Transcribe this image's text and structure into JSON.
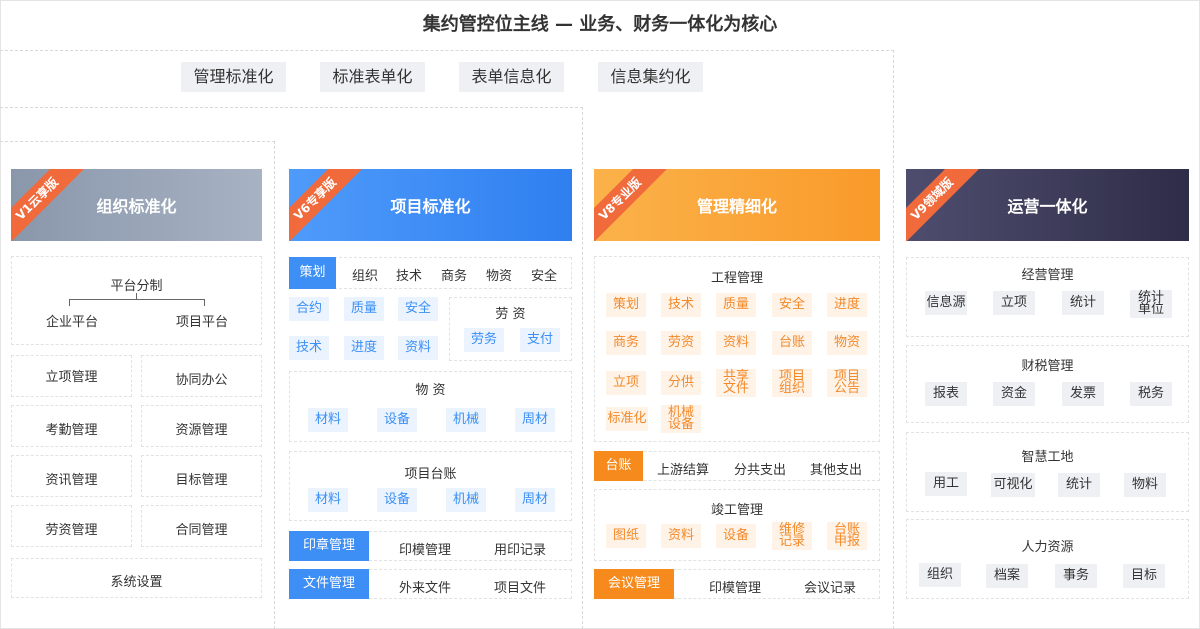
{
  "header": {
    "title": "集约管控位主线 — 业务、财务一体化为核心"
  },
  "pills": [
    "管理标准化",
    "标准表单化",
    "表单信息化",
    "信息集约化"
  ],
  "col1": {
    "ribbon": "V1云享版",
    "title": "组织标准化",
    "platform": {
      "root": "平台分制",
      "left": "企业平台",
      "right": "项目平台"
    },
    "items": [
      "立项管理",
      "协同办公",
      "考勤管理",
      "资源管理",
      "资讯管理",
      "目标管理",
      "劳资管理",
      "合同管理"
    ],
    "settings": "系统设置"
  },
  "col2": {
    "ribbon": "V6专享版",
    "title": "项目标准化",
    "tabs": [
      "策划",
      "组织",
      "技术",
      "商务",
      "物资",
      "安全"
    ],
    "grid": [
      "合约",
      "质量",
      "安全",
      "技术",
      "进度",
      "资料"
    ],
    "labor": {
      "title": "劳  资",
      "items": [
        "劳务",
        "支付"
      ]
    },
    "material": {
      "title": "物  资",
      "items": [
        "材料",
        "设备",
        "机械",
        "周材"
      ]
    },
    "ledger": {
      "title": "项目台账",
      "items": [
        "材料",
        "设备",
        "机械",
        "周材"
      ]
    },
    "seal": {
      "active": "印章管理",
      "items": [
        "印模管理",
        "用印记录"
      ]
    },
    "file": {
      "active": "文件管理",
      "items": [
        "外来文件",
        "项目文件"
      ]
    }
  },
  "col3": {
    "ribbon": "V8专业版",
    "title": "管理精细化",
    "eng": {
      "title": "工程管理",
      "items": [
        "策划",
        "技术",
        "质量",
        "安全",
        "进度",
        "商务",
        "劳资",
        "资料",
        "台账",
        "物资",
        "立项",
        "分供",
        "共享\n文件",
        "项目\n组织",
        "项目\n公告",
        "标准化",
        "机械\n设备"
      ]
    },
    "ledgerRow": {
      "active": "台账",
      "items": [
        "上游结算",
        "分共支出",
        "其他支出"
      ]
    },
    "done": {
      "title": "竣工管理",
      "items": [
        "图纸",
        "资料",
        "设备",
        "维修\n记录",
        "台账\n申报"
      ]
    },
    "meeting": {
      "active": "会议管理",
      "items": [
        "印模管理",
        "会议记录"
      ]
    }
  },
  "col4": {
    "ribbon": "V9领域版",
    "title": "运营一体化",
    "groups": [
      {
        "title": "经营管理",
        "items": [
          "信息源",
          "立项",
          "统计",
          "统计\n单位"
        ]
      },
      {
        "title": "财税管理",
        "items": [
          "报表",
          "资金",
          "发票",
          "税务"
        ]
      },
      {
        "title": "智慧工地",
        "items": [
          "用工",
          "可视化",
          "统计",
          "物料"
        ]
      },
      {
        "title": "人力资源",
        "items": [
          "组织",
          "档案",
          "事务",
          "目标"
        ]
      }
    ]
  },
  "colors": {
    "blue": "#3d8ff5",
    "orange": "#f78a1d",
    "ribbonOrange": "#f06a3c"
  }
}
